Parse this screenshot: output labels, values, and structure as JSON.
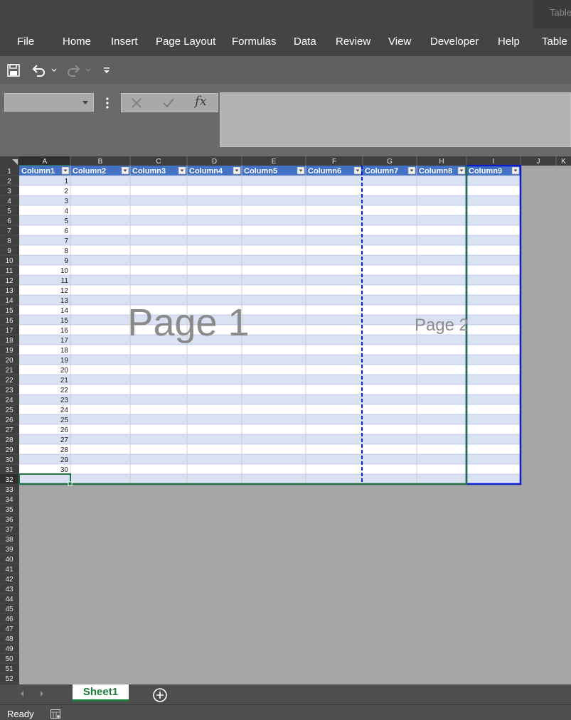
{
  "title_right": "Table",
  "menu": [
    {
      "label": "File",
      "name": "menu-file"
    },
    {
      "label": "Home",
      "name": "menu-home"
    },
    {
      "label": "Insert",
      "name": "menu-insert"
    },
    {
      "label": "Page Layout",
      "name": "menu-page-layout"
    },
    {
      "label": "Formulas",
      "name": "menu-formulas"
    },
    {
      "label": "Data",
      "name": "menu-data"
    },
    {
      "label": "Review",
      "name": "menu-review"
    },
    {
      "label": "View",
      "name": "menu-view"
    },
    {
      "label": "Developer",
      "name": "menu-developer"
    },
    {
      "label": "Help",
      "name": "menu-help"
    },
    {
      "label": "Table D",
      "name": "menu-table-design"
    }
  ],
  "qat_icons": [
    "save-icon",
    "undo-icon",
    "redo-icon",
    "customize-qat-icon"
  ],
  "formula_bar": {
    "name_box": "",
    "cancel_icon": "cancel-icon",
    "enter_icon": "enter-icon",
    "fx_label": "fx",
    "formula": ""
  },
  "grid": {
    "column_letters": [
      "A",
      "B",
      "C",
      "D",
      "E",
      "F",
      "G",
      "H",
      "I",
      "J",
      "K"
    ],
    "table_headers": [
      "Column1",
      "Column2",
      "Column3",
      "Column4",
      "Column5",
      "Column6",
      "Column7",
      "Column8",
      "Column9"
    ],
    "column1_values": [
      1,
      2,
      3,
      4,
      5,
      6,
      7,
      8,
      9,
      10,
      11,
      12,
      13,
      14,
      15,
      16,
      17,
      18,
      19,
      20,
      21,
      22,
      23,
      24,
      25,
      26,
      27,
      28,
      29,
      30
    ],
    "row_count": 52,
    "selected_cell": "A32",
    "page_labels": [
      "Page 1",
      "Page 2"
    ],
    "colors": {
      "table_header": "#4472c4",
      "band_light": "#d9e1f2",
      "band_white": "#ffffff",
      "page_break": "#0a1fcc",
      "selection": "#217346",
      "background": "#a6a6a6"
    }
  },
  "sheet_tabs": [
    {
      "label": "Sheet1",
      "active": true
    }
  ],
  "status": {
    "ready": "Ready"
  }
}
